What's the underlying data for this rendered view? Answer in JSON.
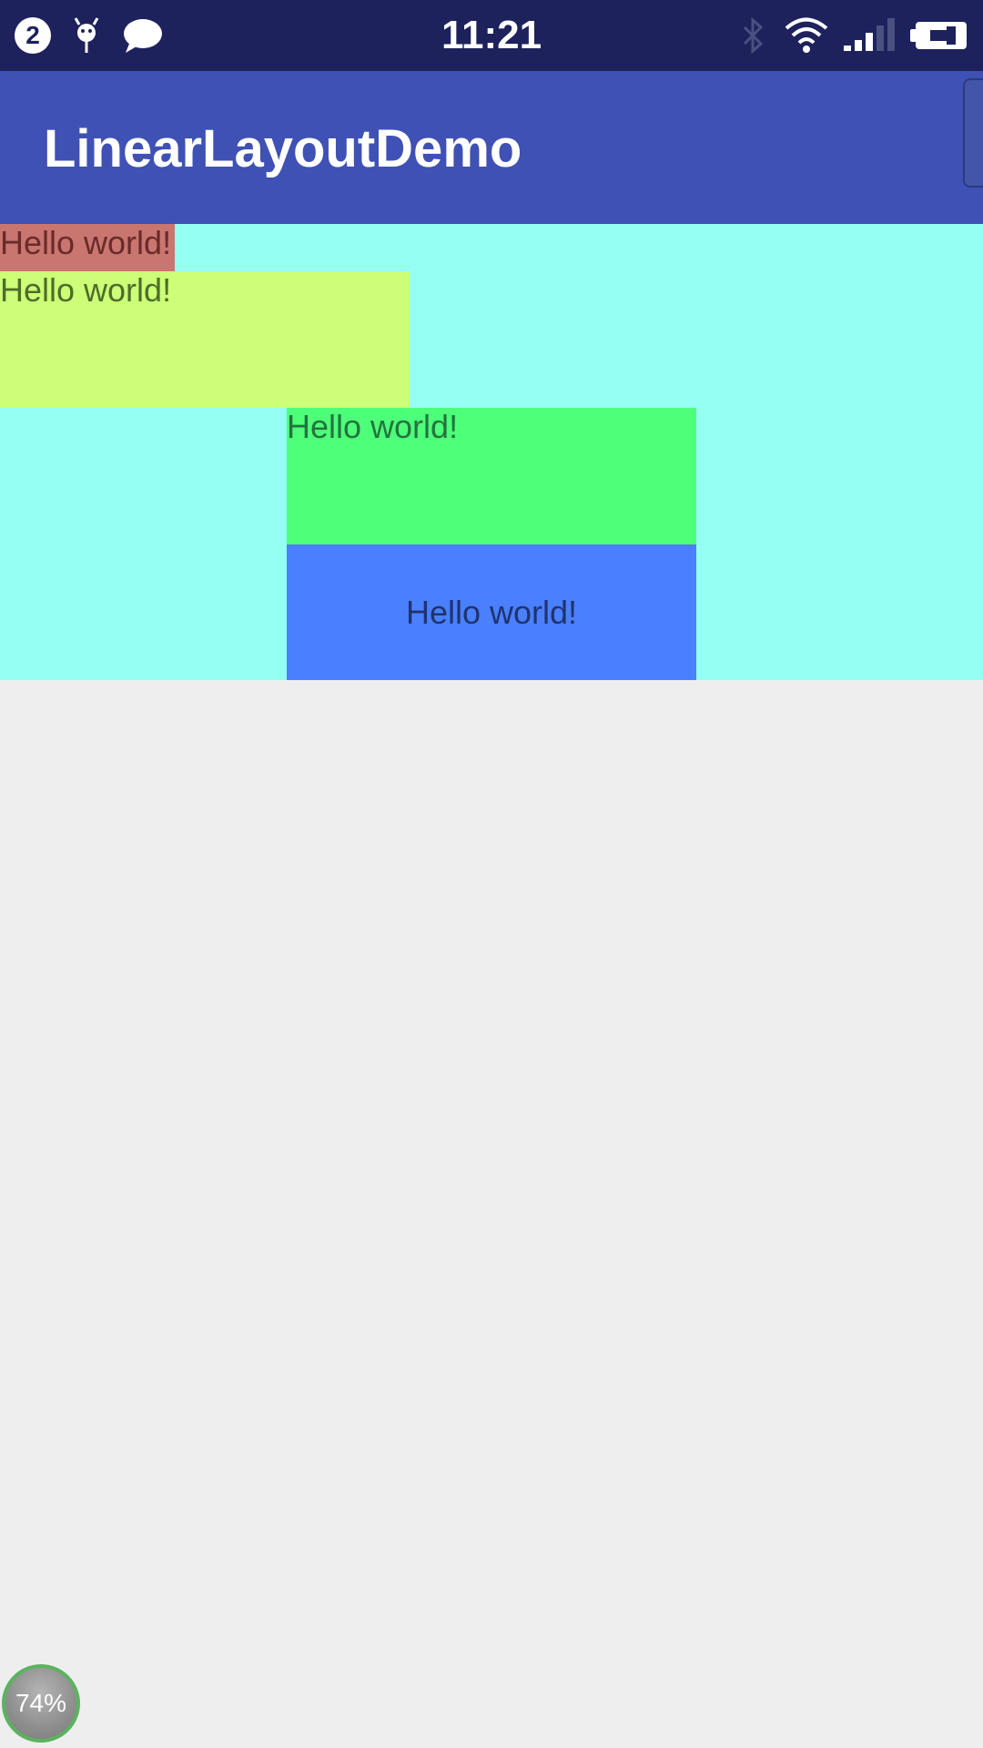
{
  "status_bar": {
    "time": "11:21",
    "notification_count": "2",
    "left_icons": [
      "android-debug-icon",
      "chat-bubble-icon"
    ],
    "right_icons": [
      "bluetooth-icon",
      "wifi-icon",
      "signal-icon",
      "battery-charging-icon"
    ]
  },
  "app_bar": {
    "title": "LinearLayoutDemo",
    "color": "#3F51B5"
  },
  "content": {
    "background_color": "#96FFF4",
    "text_views": [
      {
        "text": "Hello world!",
        "color": "#C97670"
      },
      {
        "text": "Hello world!",
        "color": "#CCFF77"
      },
      {
        "text": "Hello world!",
        "color": "#4EFF7A"
      },
      {
        "text": "Hello world!",
        "color": "#4A80FF"
      }
    ]
  },
  "floating_ball": {
    "label": "74%",
    "value": 0.74
  }
}
